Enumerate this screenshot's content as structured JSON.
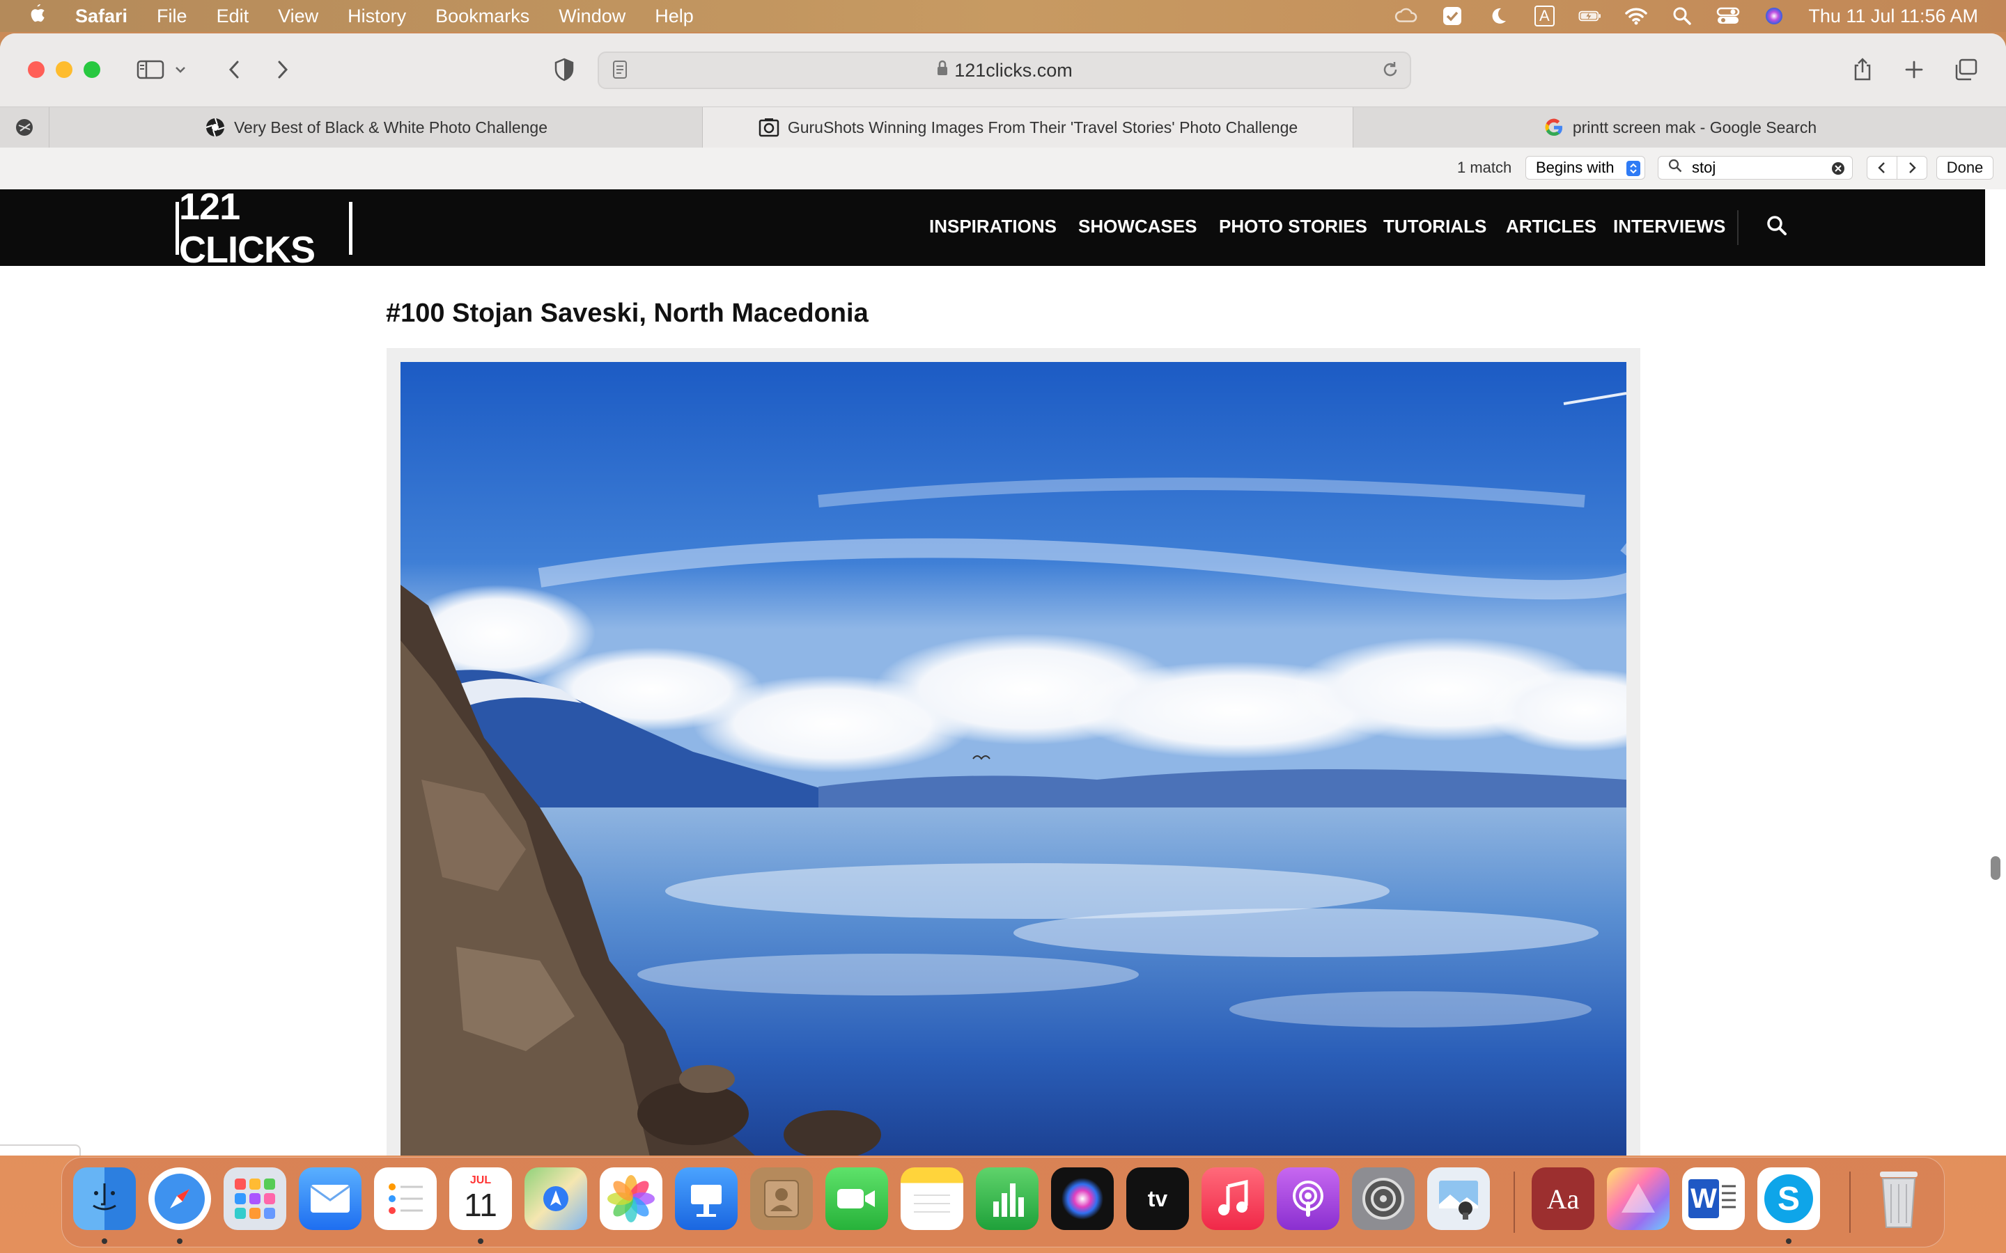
{
  "menubar": {
    "apple": "",
    "items": [
      "Safari",
      "File",
      "Edit",
      "View",
      "History",
      "Bookmarks",
      "Window",
      "Help"
    ],
    "status_icons": [
      "creative-cloud-icon",
      "checkmark-icon",
      "moon-icon",
      "input-source-icon",
      "battery-icon",
      "wifi-icon",
      "spotlight-icon",
      "control-center-icon",
      "siri-icon"
    ],
    "input_source": "A",
    "datetime": "Thu 11 Jul  11:56 AM"
  },
  "toolbar": {
    "url": "121clicks.com"
  },
  "tabs": [
    {
      "title": "Very Best of Black & White Photo Challenge",
      "icon": "aperture-icon",
      "active": false
    },
    {
      "title": "GuruShots Winning Images From Their 'Travel Stories' Photo Challenge",
      "icon": "camera-icon",
      "active": true
    },
    {
      "title": "printt screen mak - Google Search",
      "icon": "google-icon",
      "active": false
    }
  ],
  "findbar": {
    "match_count": "1 match",
    "mode": "Begins with",
    "query": "stoj",
    "done_label": "Done"
  },
  "site": {
    "logo": "121 CLICKS",
    "nav": [
      "INSPIRATIONS",
      "SHOWCASES",
      "PHOTO STORIES",
      "TUTORIALS",
      "ARTICLES",
      "INTERVIEWS"
    ]
  },
  "article": {
    "heading": "#100 Stojan Saveski, North Macedonia"
  },
  "dock": {
    "calendar_month": "JUL",
    "calendar_day": "11",
    "apps": [
      "finder",
      "safari",
      "launchpad",
      "mail",
      "reminders",
      "calendar",
      "maps",
      "photos",
      "keynote",
      "contacts",
      "facetime",
      "notes",
      "numbers",
      "siri",
      "tv",
      "music",
      "podcasts",
      "system-preferences",
      "preview",
      "dictionary",
      "grapher",
      "word",
      "skype",
      "trash"
    ],
    "tv_label": "tv",
    "dictionary_label": "Aa",
    "word_label": "W",
    "skype_label": "S"
  },
  "colors": {
    "nav_bg": "#0b0b0b",
    "toolbar_bg": "#eceae9",
    "close": "#ff5f57",
    "minimize": "#febc2e",
    "zoom": "#28c840"
  }
}
